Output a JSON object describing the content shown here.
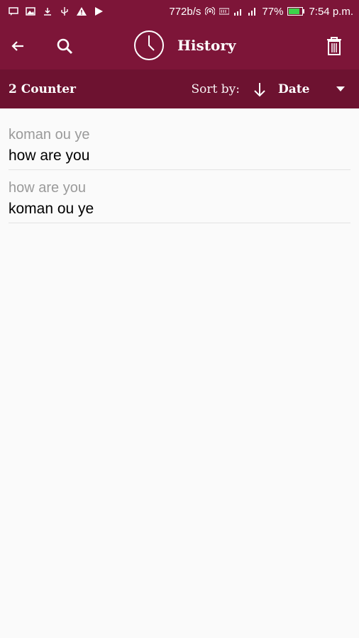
{
  "status_bar": {
    "left_icons": [
      "chat-icon",
      "image-icon",
      "download-icon",
      "usb-icon",
      "warning-icon",
      "play-icon"
    ],
    "speed": "772b/s",
    "battery": "77%",
    "time": "7:54 p.m."
  },
  "app_bar": {
    "title": "History"
  },
  "sub_bar": {
    "counter": "2 Counter",
    "sort_label": "Sort by:",
    "sort_value": "Date"
  },
  "history": [
    {
      "source": "koman ou ye",
      "translation": "how are you"
    },
    {
      "source": "how are you",
      "translation": "koman ou ye"
    }
  ],
  "colors": {
    "primary": "#7d1538",
    "secondary": "#6d1230",
    "background": "#fafafa"
  }
}
